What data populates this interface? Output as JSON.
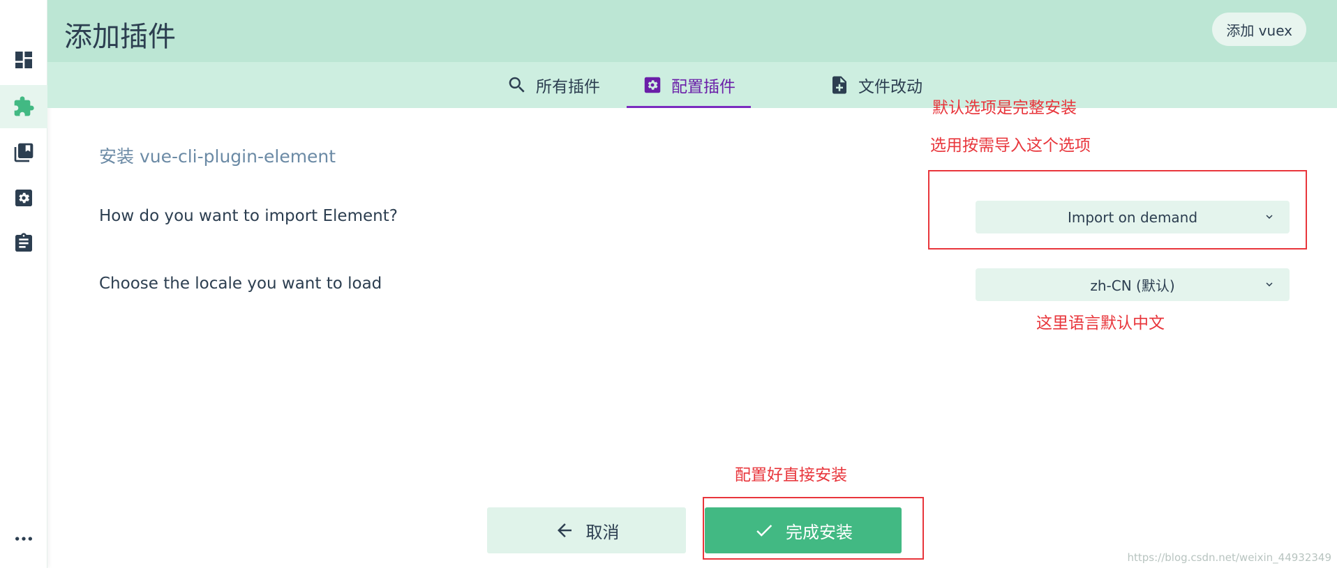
{
  "header": {
    "title": "添加插件",
    "add_vuex_label": "添加 vuex"
  },
  "sidebar": {
    "items": [
      {
        "icon": "dashboard-icon",
        "active": false
      },
      {
        "icon": "puzzle-plugin-icon",
        "active": true
      },
      {
        "icon": "library-books-icon",
        "active": false
      },
      {
        "icon": "settings-box-icon",
        "active": false
      },
      {
        "icon": "clipboard-task-icon",
        "active": false
      },
      {
        "icon": "more-dots-icon",
        "active": false
      }
    ]
  },
  "tabs": [
    {
      "label": "所有插件",
      "icon": "search-icon",
      "active": false
    },
    {
      "label": "配置插件",
      "icon": "settings-box-icon",
      "active": true
    },
    {
      "label": "文件改动",
      "icon": "file-plus-icon",
      "active": false
    }
  ],
  "form": {
    "section_title": "安装 vue-cli-plugin-element",
    "fields": [
      {
        "label": "How do you want to import Element?",
        "value": "Import on demand"
      },
      {
        "label": "Choose the locale you want to load",
        "value": "zh-CN (默认)"
      }
    ]
  },
  "annotations": {
    "default_full_install": "默认选项是完整安装",
    "choose_on_demand": "选用按需导入这个选项",
    "locale_default_cn": "这里语言默认中文",
    "configure_then_install": "配置好直接安装"
  },
  "actions": {
    "cancel_label": "取消",
    "finish_label": "完成安装"
  },
  "watermark": "https://blog.csdn.net/weixin_44932349",
  "colors": {
    "header_bg": "#bce6d4",
    "tabbar_bg": "#cdeee0",
    "accent_green": "#42b983",
    "active_tab": "#7b2cbf",
    "annotation_red": "#e8353b"
  }
}
